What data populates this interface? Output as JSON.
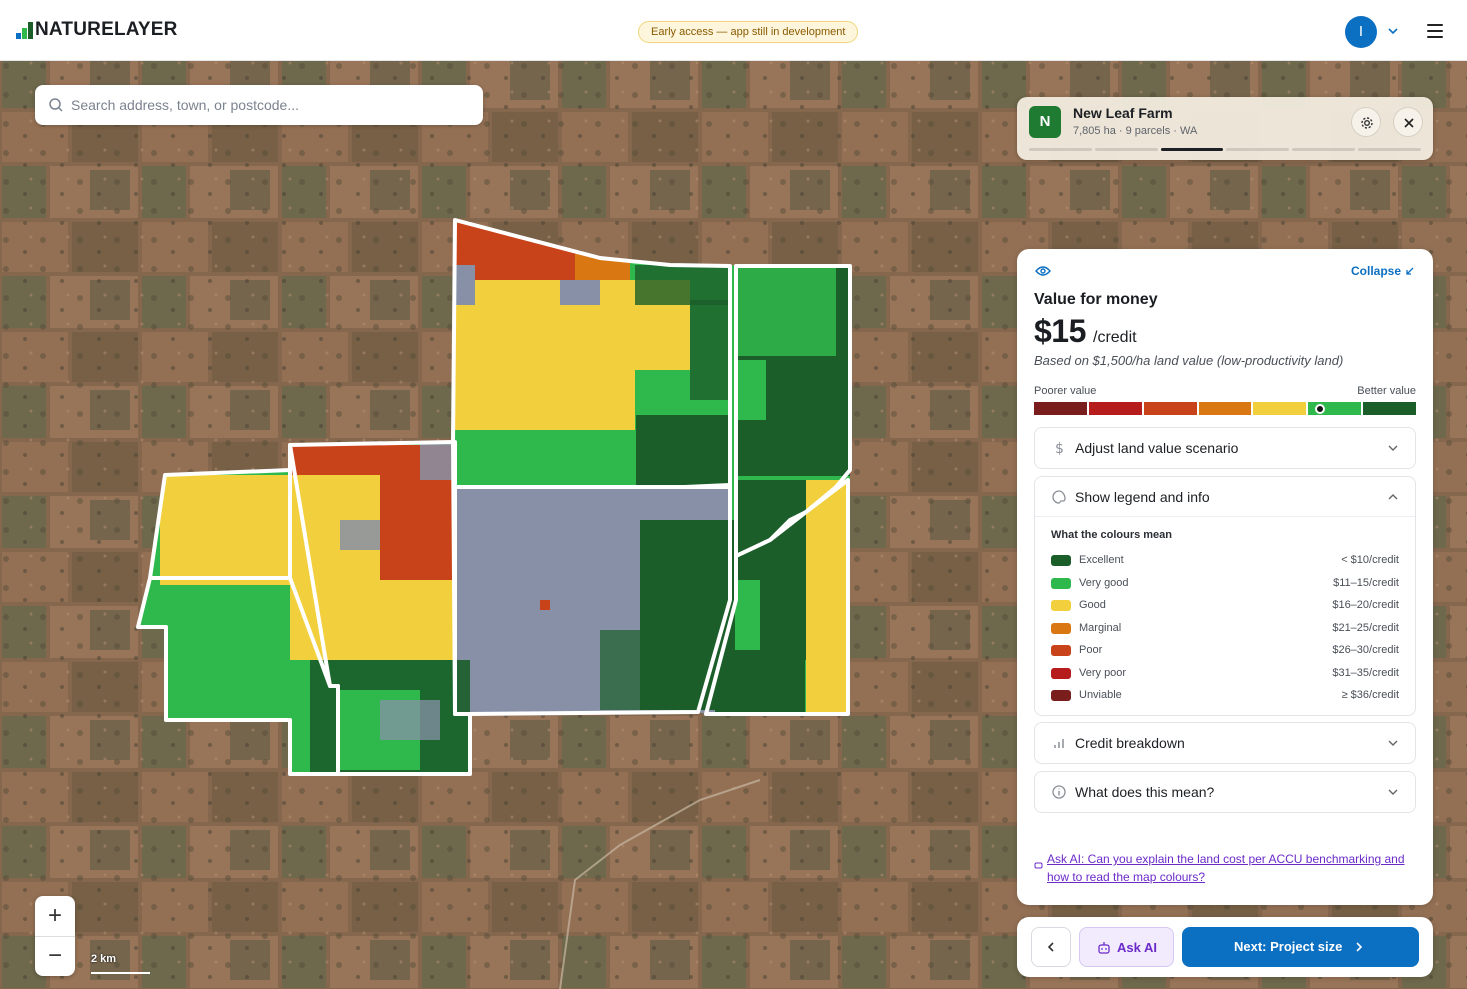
{
  "header": {
    "logo_text": "NATURELAYER",
    "badge": "Early access — app still in development",
    "avatar_initial": "I"
  },
  "map": {
    "search_placeholder": "Search address, town, or postcode...",
    "zoom_in": "+",
    "zoom_out": "−",
    "scale_label": "2 km"
  },
  "farm": {
    "avatar_initial": "N",
    "name": "New Leaf Farm",
    "meta": "7,805 ha · 9 parcels · WA",
    "progress_steps": 6,
    "active_step": 3
  },
  "panel": {
    "collapse_label": "Collapse",
    "title": "Value for money",
    "price": "$15",
    "price_unit": "/credit",
    "note": "Based on $1,500/ha land value (low-productivity land)",
    "scale_left": "Poorer value",
    "scale_right": "Better value",
    "scale_colors": [
      "#7a1d1d",
      "#b71c1c",
      "#c9431a",
      "#d97713",
      "#f2cf3c",
      "#2fb84c",
      "#1b5e2a"
    ],
    "marker_segment": 6,
    "accordions": {
      "adjust": "Adjust land value scenario",
      "legend": "Show legend and info",
      "breakdown": "Credit breakdown",
      "meaning": "What does this mean?"
    },
    "legend_title": "What the colours mean",
    "legend": [
      {
        "name": "Excellent",
        "range": "< $10/credit",
        "color": "#1b5e2a"
      },
      {
        "name": "Very good",
        "range": "$11–15/credit",
        "color": "#2fb84c"
      },
      {
        "name": "Good",
        "range": "$16–20/credit",
        "color": "#f2cf3c"
      },
      {
        "name": "Marginal",
        "range": "$21–25/credit",
        "color": "#d97713"
      },
      {
        "name": "Poor",
        "range": "$26–30/credit",
        "color": "#c9431a"
      },
      {
        "name": "Very poor",
        "range": "$31–35/credit",
        "color": "#b71c1c"
      },
      {
        "name": "Unviable",
        "range": "≥ $36/credit",
        "color": "#7a1d1d"
      }
    ],
    "ask_link": "Ask AI: Can you explain the land cost per ACCU benchmarking and how to read the map colours?"
  },
  "bottom": {
    "ask_label": "Ask AI",
    "next_label": "Next: Project size"
  },
  "colors": {
    "accent": "#0b6fc2",
    "ai_purple": "#6b2bc9"
  }
}
